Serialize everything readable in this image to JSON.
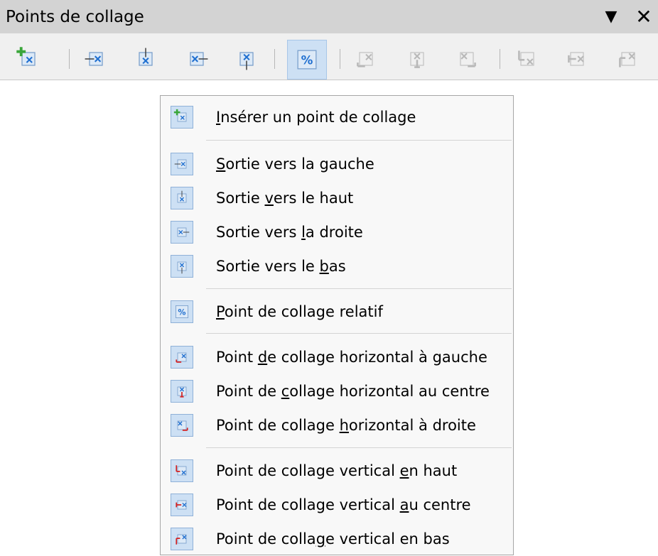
{
  "panel": {
    "title": "Points de collage",
    "dropdown_glyph": "▼",
    "close_glyph": "✕"
  },
  "toolbar": {
    "buttons": [
      {
        "name": "insert-glue-point-tool",
        "icon": "insert-gluepoint-icon",
        "active": false
      },
      {
        "name": "exit-left-tool",
        "icon": "exit-left-icon",
        "active": false
      },
      {
        "name": "exit-top-tool",
        "icon": "exit-top-icon",
        "active": false
      },
      {
        "name": "exit-right-tool",
        "icon": "exit-right-icon",
        "active": false
      },
      {
        "name": "exit-bottom-tool",
        "icon": "exit-bottom-icon",
        "active": false
      },
      {
        "name": "relative-glue-point-tool",
        "icon": "percent-icon",
        "active": true
      },
      {
        "name": "horizontal-left-tool",
        "icon": "align-left-icon",
        "active": false,
        "disabled": true
      },
      {
        "name": "horizontal-center-tool",
        "icon": "align-center-icon",
        "active": false,
        "disabled": true
      },
      {
        "name": "horizontal-right-tool",
        "icon": "align-right-icon",
        "active": false,
        "disabled": true
      },
      {
        "name": "vertical-top-tool",
        "icon": "align-top-icon",
        "active": false,
        "disabled": true
      },
      {
        "name": "vertical-center-tool",
        "icon": "align-middle-icon",
        "active": false,
        "disabled": true
      },
      {
        "name": "vertical-bottom-tool",
        "icon": "align-bottom-icon",
        "active": false,
        "disabled": true
      }
    ]
  },
  "menu": {
    "items": [
      {
        "pre": "",
        "mn": "I",
        "post": "nsérer un point de collage",
        "icon": "insert-gluepoint-icon"
      },
      {
        "pre": "",
        "mn": "S",
        "post": "ortie vers la gauche",
        "icon": "exit-left-icon"
      },
      {
        "pre": "Sortie ",
        "mn": "v",
        "post": "ers le haut",
        "icon": "exit-top-icon"
      },
      {
        "pre": "Sortie vers ",
        "mn": "l",
        "post": "a droite",
        "icon": "exit-right-icon"
      },
      {
        "pre": "Sortie vers le ",
        "mn": "b",
        "post": "as",
        "icon": "exit-bottom-icon"
      },
      {
        "pre": "",
        "mn": "P",
        "post": "oint de collage relatif",
        "icon": "percent-icon"
      },
      {
        "pre": "Point ",
        "mn": "d",
        "post": "e collage horizontal à gauche",
        "icon": "align-left-icon"
      },
      {
        "pre": "Point de ",
        "mn": "c",
        "post": "ollage horizontal au centre",
        "icon": "align-center-icon"
      },
      {
        "pre": "Point de collage ",
        "mn": "h",
        "post": "orizontal à droite",
        "icon": "align-right-icon"
      },
      {
        "pre": "Point de collage vertical ",
        "mn": "e",
        "post": "n haut",
        "icon": "align-top-icon"
      },
      {
        "pre": "Point de collage vertical ",
        "mn": "a",
        "post": "u centre",
        "icon": "align-middle-icon"
      },
      {
        "pre": "Point de colla",
        "mn": "g",
        "post": "e vertical en bas",
        "icon": "align-bottom-icon"
      }
    ]
  },
  "colors": {
    "titlebar": "#d3d3d3",
    "toolbar": "#f0f0f0",
    "menu_bg": "#f8f8f8",
    "icon_bg": "#cde0f4",
    "accent_blue": "#1f6fd0",
    "accent_red": "#d42020",
    "accent_green": "#3aa63a"
  }
}
